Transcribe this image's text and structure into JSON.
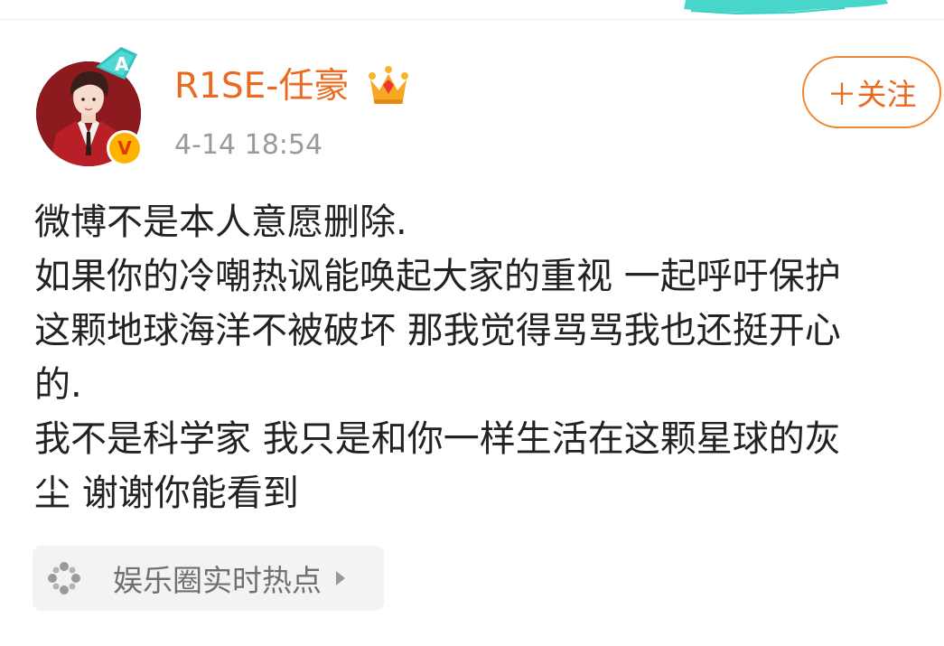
{
  "user": {
    "name": "R1SE-任豪",
    "timestamp": "4-14 18:54",
    "verified_label": "V",
    "tag_label": "A"
  },
  "follow_button": {
    "label": "＋关注"
  },
  "post": {
    "lines": [
      "微博不是本人意愿删除.",
      "如果你的冷嘲热讽能唤起大家的重视 一起呼吁保护",
      "这颗地球海洋不被破坏 那我觉得骂骂我也还挺开心",
      "的.",
      "我不是科学家 我只是和你一样生活在这颗星球的灰",
      "尘 谢谢你能看到"
    ]
  },
  "topic": {
    "label": "娱乐圈实时热点"
  },
  "colors": {
    "username": "#ea6a1f",
    "follow_border": "#f0862f",
    "timestamp": "#9a9a9a",
    "body_text": "#222222",
    "brush_accent": "#34d1c4"
  },
  "icons": {
    "crown": "crown-icon",
    "verified": "verified-badge-icon",
    "tag": "a-tag-icon",
    "topic": "topic-dots-icon",
    "arrow": "chevron-right-icon"
  }
}
